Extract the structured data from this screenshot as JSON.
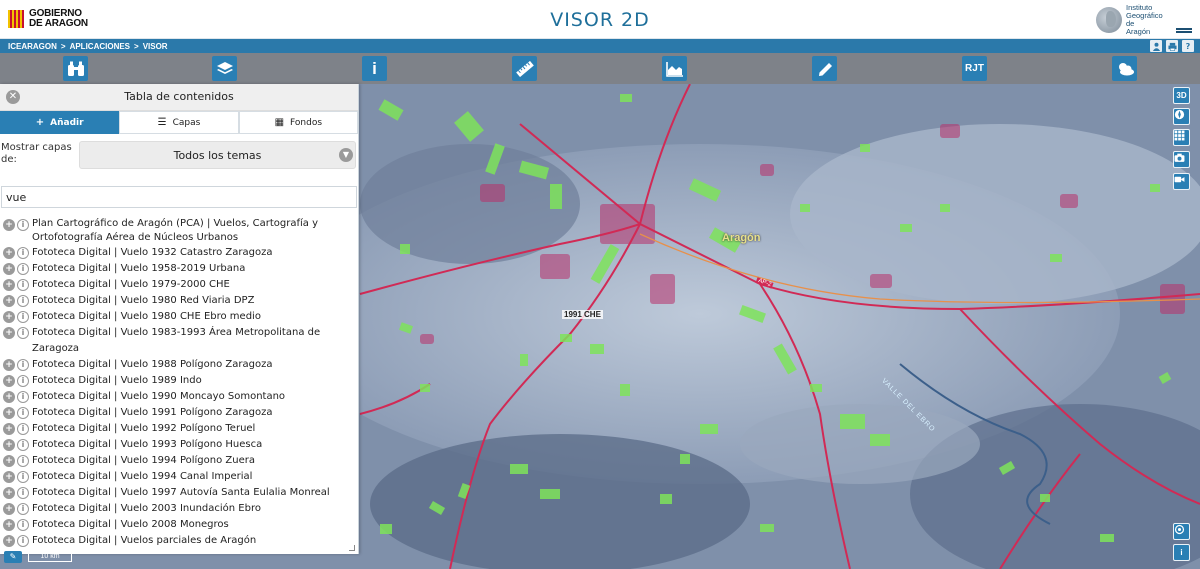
{
  "header": {
    "gov_logo_line1": "GOBIERNO",
    "gov_logo_line2": "DE ARAGON",
    "app_title": "VISOR 2D",
    "ign_line1": "Instituto",
    "ign_line2": "Geográfico de",
    "ign_line3": "Aragón"
  },
  "breadcrumb": [
    "ICEARAGON",
    ">",
    "APLICACIONES",
    ">",
    "VISOR"
  ],
  "user_tools": [
    "user-icon",
    "print-icon",
    "help-icon"
  ],
  "toolbar": [
    {
      "name": "binoculars-icon",
      "glyph": "⚲"
    },
    {
      "name": "layers-icon",
      "glyph": "◈"
    },
    {
      "name": "info-icon",
      "glyph": "i"
    },
    {
      "name": "ruler-icon",
      "glyph": "📏"
    },
    {
      "name": "profile-chart-icon",
      "glyph": "▲"
    },
    {
      "name": "pencil-icon",
      "glyph": "✎"
    },
    {
      "name": "rjt-icon",
      "glyph": "RJT"
    },
    {
      "name": "weather-icon",
      "glyph": "☁"
    }
  ],
  "map": {
    "label_region": "Aragón",
    "label_road_1": "1991 CHE",
    "label_river": "VALLE DEL EBRO",
    "label_highway": "AP-2"
  },
  "right_controls": {
    "view_3d": "3D",
    "info": "i"
  },
  "scale": {
    "label": "10 km"
  },
  "panel": {
    "title": "Tabla de contenidos",
    "tabs": [
      {
        "label": "Añadir",
        "icon": "+"
      },
      {
        "label": "Capas",
        "icon": "☰"
      },
      {
        "label": "Fondos",
        "icon": "▦"
      }
    ],
    "filter_label": "Mostrar capas de:",
    "theme_selected": "Todos los temas",
    "search_value": "vue",
    "results": [
      "Plan Cartográfico de Aragón (PCA) | Vuelos, Cartografía y Ortofotografía Aérea de Núcleos Urbanos",
      "Fototeca Digital | Vuelo 1932 Catastro Zaragoza",
      "Fototeca Digital | Vuelo 1958-2019 Urbana",
      "Fototeca Digital | Vuelo 1979-2000 CHE",
      "Fototeca Digital | Vuelo 1980 Red Viaria DPZ",
      "Fototeca Digital | Vuelo 1980 CHE Ebro medio",
      "Fototeca Digital | Vuelo 1983-1993 Área Metropolitana de Zaragoza",
      "Fototeca Digital | Vuelo 1988 Polígono Zaragoza",
      "Fototeca Digital | Vuelo 1989 Indo",
      "Fototeca Digital | Vuelo 1990 Moncayo Somontano",
      "Fototeca Digital | Vuelo 1991 Polígono Zaragoza",
      "Fototeca Digital | Vuelo 1992 Polígono Teruel",
      "Fototeca Digital | Vuelo 1993 Polígono Huesca",
      "Fototeca Digital | Vuelo 1994 Polígono Zuera",
      "Fototeca Digital | Vuelo 1994 Canal Imperial",
      "Fototeca Digital | Vuelo 1997 Autovía Santa Eulalia Monreal",
      "Fototeca Digital | Vuelo 2003 Inundación Ebro",
      "Fototeca Digital | Vuelo 2008 Monegros",
      "Fototeca Digital | Vuelos parciales de Aragón"
    ]
  },
  "colors": {
    "primary_blue": "#2a7fb4",
    "title_blue": "#1e6f9a",
    "flight_green": "#7ee35a",
    "road_red": "#d12a55",
    "urban_magenta": "#b8306a"
  }
}
